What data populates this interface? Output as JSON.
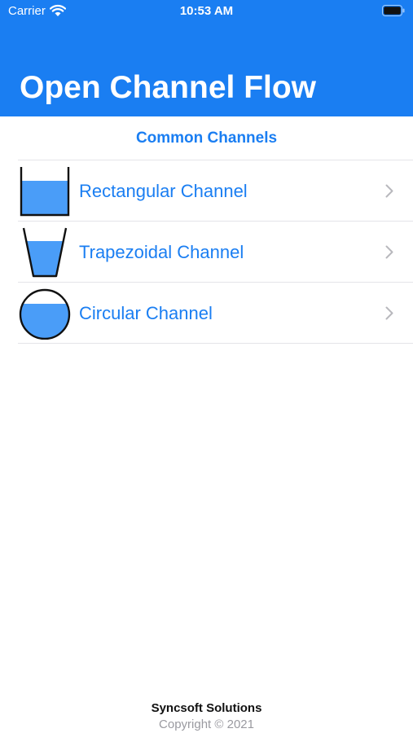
{
  "status_bar": {
    "carrier": "Carrier",
    "time": "10:53 AM"
  },
  "header": {
    "title": "Open Channel Flow",
    "background_color": "#1a7ef2"
  },
  "section": {
    "title": "Common Channels"
  },
  "channels": [
    {
      "label": "Rectangular Channel",
      "icon": "rectangular-channel-icon"
    },
    {
      "label": "Trapezoidal Channel",
      "icon": "trapezoidal-channel-icon"
    },
    {
      "label": "Circular Channel",
      "icon": "circular-channel-icon"
    }
  ],
  "footer": {
    "company": "Syncsoft Solutions",
    "copyright": "Copyright © 2021"
  },
  "colors": {
    "accent": "#1a7ef2",
    "water": "#4a9df8"
  }
}
